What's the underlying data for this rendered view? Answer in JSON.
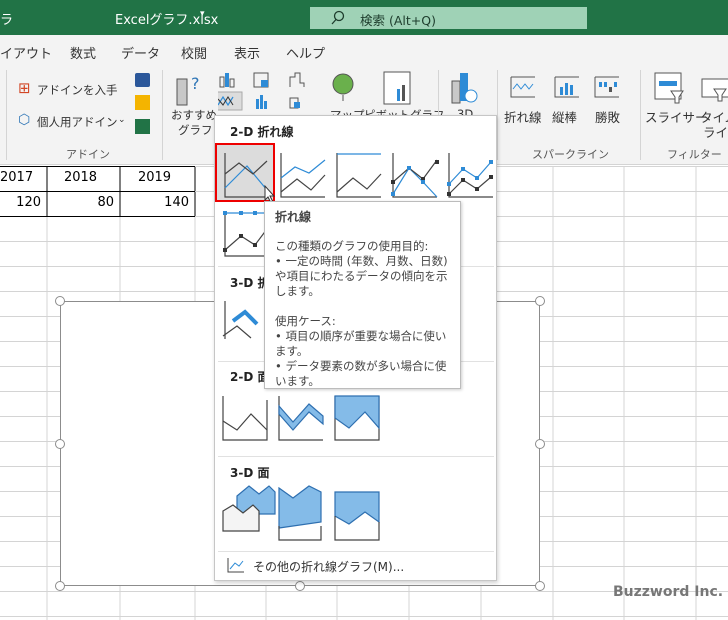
{
  "titlebar": {
    "left_fragment": "ラ",
    "filename": "Excelグラフ.xlsx",
    "search_placeholder": "検索 (Alt+Q)"
  },
  "menu_tabs": [
    "イアウト",
    "数式",
    "データ",
    "校閲",
    "表示",
    "ヘルプ"
  ],
  "ribbon": {
    "addins": {
      "get": "アドインを入手",
      "personal": "個人用アドイン",
      "group": "アドイン"
    },
    "charts": {
      "recommended_1": "おすすめ",
      "recommended_2": "グラフ",
      "map": "マップ",
      "pivot": "ピボットグラフ",
      "threed": "3D"
    },
    "sparklines": {
      "line": "折れ線",
      "column": "縦棒",
      "winloss": "勝敗",
      "group": "スパークライン"
    },
    "filters": {
      "slicer": "スライサー",
      "timeline_1": "タイム",
      "timeline_2": "ライン",
      "group": "フィルター"
    }
  },
  "sheet": {
    "headers": [
      "2017",
      "2018",
      "2019"
    ],
    "values": [
      "120",
      "80",
      "140"
    ]
  },
  "dropdown": {
    "sections": [
      "2-D 折れ線",
      "3-D 折れ線",
      "2-D 面",
      "3-D 面"
    ],
    "more": "その他の折れ線グラフ(M)...",
    "accent": "#2e8bd6"
  },
  "tooltip": {
    "title": "折れ線",
    "purpose_heading": "この種類のグラフの使用目的:",
    "purpose_1": "• 一定の時間 (年数、月数、日数) や項目にわたるデータの傾向を示します。",
    "usage_heading": "使用ケース:",
    "usage_1": "• 項目の順序が重要な場合に使います。",
    "usage_2": "• データ要素の数が多い場合に使います。"
  },
  "watermark": "Buzzword Inc."
}
